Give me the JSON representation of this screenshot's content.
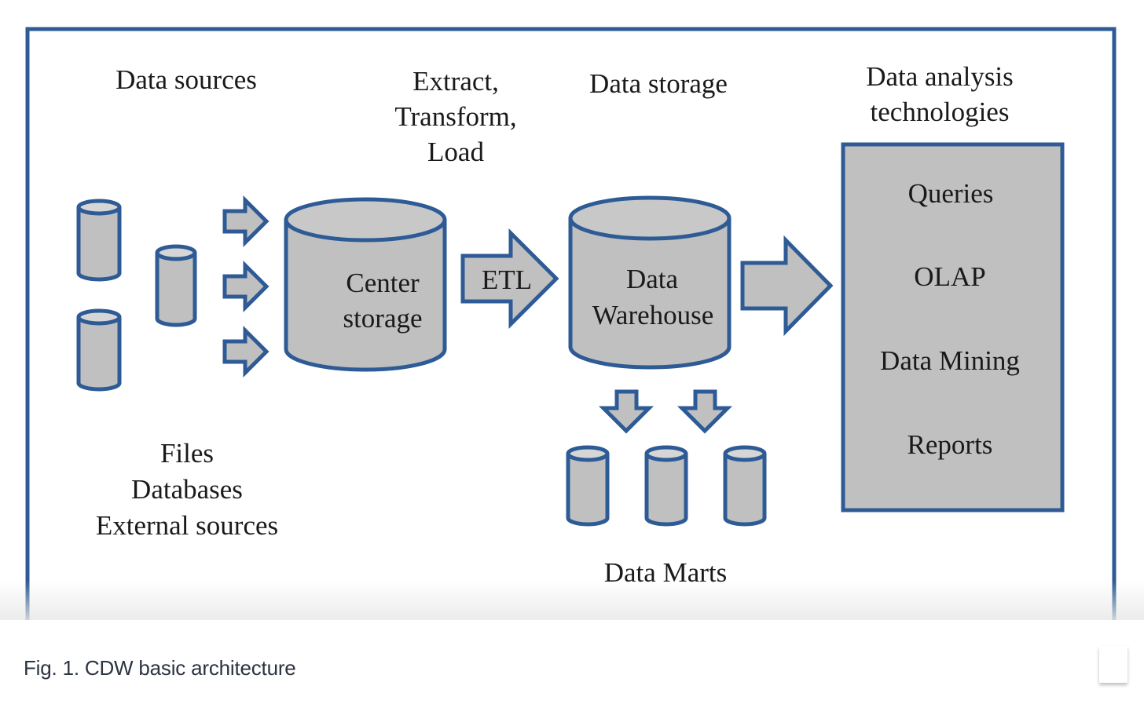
{
  "diagram": {
    "headers": {
      "data_sources": "Data sources",
      "etl": [
        "Extract,",
        "Transform,",
        "Load"
      ],
      "data_storage": "Data storage",
      "analysis": [
        "Data analysis",
        "technologies"
      ]
    },
    "center_storage": [
      "Center",
      "storage"
    ],
    "etl_arrow_label": "ETL",
    "warehouse": [
      "Data",
      "Warehouse"
    ],
    "analysis_items": [
      "Queries",
      "OLAP",
      "Data Mining",
      "Reports"
    ],
    "source_types": [
      "Files",
      "Databases",
      "External sources"
    ],
    "data_marts_label": "Data Marts",
    "colors": {
      "stroke": "#2e5b95",
      "fill": "#c0c0c0"
    }
  },
  "caption": {
    "text": "Fig. 1. CDW basic architecture"
  }
}
